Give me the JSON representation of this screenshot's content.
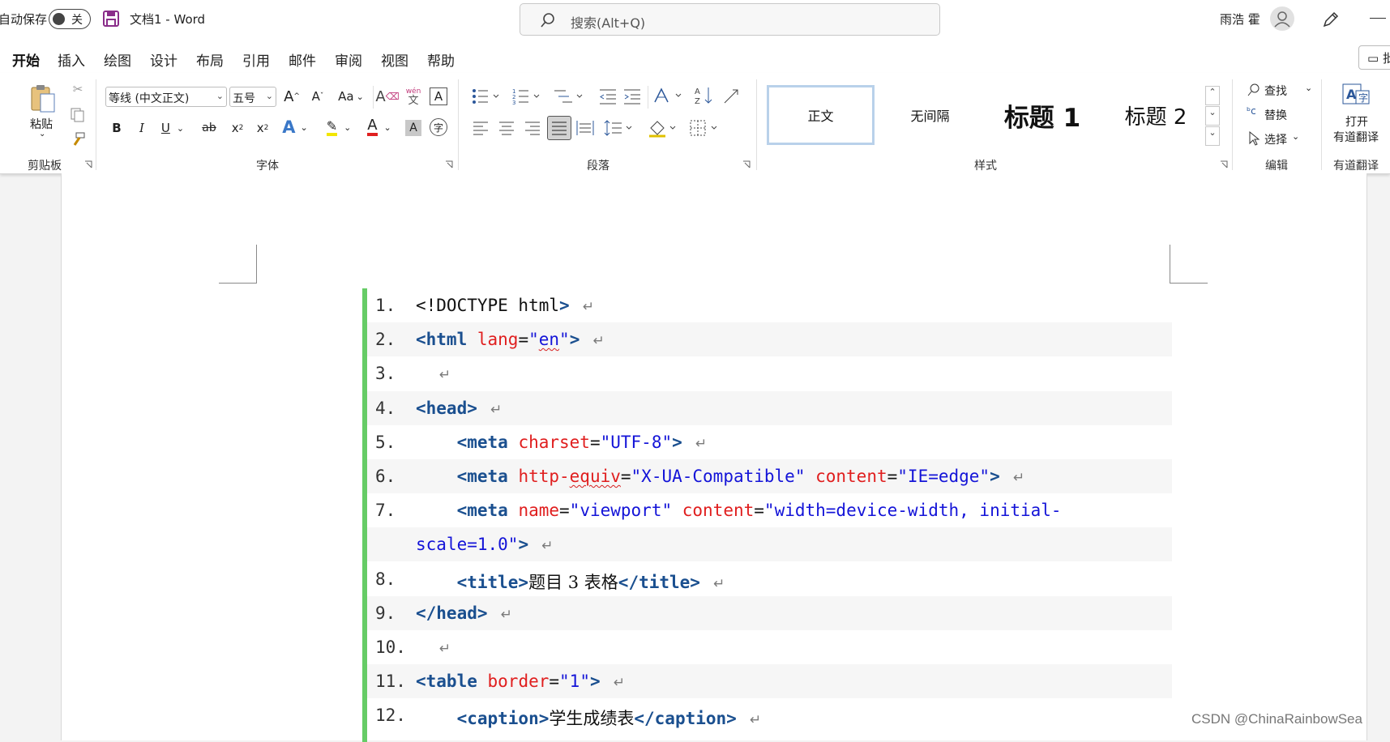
{
  "titlebar": {
    "autosave_label": "自动保存",
    "autosave_state": "关",
    "doc_name": "文档1  -  Word",
    "search_placeholder": "搜索(Alt+Q)",
    "user_name": "雨浩 霍"
  },
  "tabs": [
    {
      "label": "开始",
      "active": true
    },
    {
      "label": "插入"
    },
    {
      "label": "绘图"
    },
    {
      "label": "设计"
    },
    {
      "label": "布局"
    },
    {
      "label": "引用"
    },
    {
      "label": "邮件"
    },
    {
      "label": "审阅"
    },
    {
      "label": "视图"
    },
    {
      "label": "帮助"
    }
  ],
  "comment_button": "批",
  "ribbon": {
    "clipboard": {
      "paste_label": "粘贴",
      "group_label": "剪贴板"
    },
    "font": {
      "font_name": "等线 (中文正文)",
      "font_size": "五号",
      "change_case": "Aa",
      "group_label": "字体",
      "bold": "B",
      "italic": "I",
      "underline": "U",
      "strike": "ab",
      "subscript": "x",
      "superscript": "x",
      "text_effects": "A",
      "font_color": "A",
      "char_shading": "A",
      "phonetic": "wén",
      "phonetic_char": "文",
      "grow": "A",
      "shrink": "A",
      "clear": "A",
      "border_char": "A",
      "enclose": "字"
    },
    "paragraph": {
      "group_label": "段落"
    },
    "styles": {
      "items": [
        {
          "label": "正文",
          "selected": true
        },
        {
          "label": "无间隔"
        },
        {
          "label": "标题 1"
        },
        {
          "label": "标题 2"
        }
      ],
      "group_label": "样式"
    },
    "editing": {
      "find": "查找",
      "replace": "替换",
      "select": "选择",
      "group_label": "编辑"
    },
    "youdao": {
      "open_line1": "打开",
      "open_line2": "有道翻译",
      "group_label": "有道翻译"
    }
  },
  "code_lines": [
    {
      "num": "1.",
      "segments": [
        {
          "t": "<!DOCTYPE html",
          "c": "plain"
        },
        {
          "t": ">",
          "c": "tag"
        }
      ]
    },
    {
      "num": "2.",
      "segments": [
        {
          "t": "<html ",
          "c": "tag"
        },
        {
          "t": "lang",
          "c": "attr"
        },
        {
          "t": "=",
          "c": "plain"
        },
        {
          "t": "\"",
          "c": "val"
        },
        {
          "t": "en",
          "c": "val",
          "squig": true
        },
        {
          "t": "\"",
          "c": "val"
        },
        {
          "t": ">",
          "c": "tag"
        }
      ]
    },
    {
      "num": "3.",
      "segments": [
        {
          "t": " ",
          "c": "plain"
        }
      ]
    },
    {
      "num": "4.",
      "segments": [
        {
          "t": "<head>",
          "c": "tag"
        }
      ]
    },
    {
      "num": "5.",
      "segments": [
        {
          "t": "    <meta ",
          "c": "tag"
        },
        {
          "t": "charset",
          "c": "attr"
        },
        {
          "t": "=",
          "c": "plain"
        },
        {
          "t": "\"UTF-8\"",
          "c": "val"
        },
        {
          "t": ">",
          "c": "tag"
        }
      ]
    },
    {
      "num": "6.",
      "segments": [
        {
          "t": "    <meta ",
          "c": "tag"
        },
        {
          "t": "http-",
          "c": "attr"
        },
        {
          "t": "equiv",
          "c": "attr",
          "squig": true
        },
        {
          "t": "=",
          "c": "plain"
        },
        {
          "t": "\"X-UA-Compatible\" ",
          "c": "val"
        },
        {
          "t": "content",
          "c": "attr"
        },
        {
          "t": "=",
          "c": "plain"
        },
        {
          "t": "\"IE=edge\"",
          "c": "val"
        },
        {
          "t": ">",
          "c": "tag"
        }
      ]
    },
    {
      "num": "7.",
      "segments": [
        {
          "t": "    <meta ",
          "c": "tag"
        },
        {
          "t": "name",
          "c": "attr"
        },
        {
          "t": "=",
          "c": "plain"
        },
        {
          "t": "\"viewport\" ",
          "c": "val"
        },
        {
          "t": "content",
          "c": "attr"
        },
        {
          "t": "=",
          "c": "plain"
        },
        {
          "t": "\"width=device-width, initial-",
          "c": "val"
        }
      ],
      "nomark": true
    },
    {
      "num": "",
      "segments": [
        {
          "t": "scale=1.0\"",
          "c": "val"
        },
        {
          "t": ">",
          "c": "tag"
        }
      ],
      "wrap": true
    },
    {
      "num": "8.",
      "segments": [
        {
          "t": "    <title>",
          "c": "tag"
        },
        {
          "t": "题目 3 表格",
          "c": "plain",
          "cjk": true
        },
        {
          "t": "</title>",
          "c": "tag"
        }
      ]
    },
    {
      "num": "9.",
      "segments": [
        {
          "t": "</head>",
          "c": "tag"
        }
      ]
    },
    {
      "num": "10.",
      "segments": [
        {
          "t": " ",
          "c": "plain"
        }
      ]
    },
    {
      "num": "11.",
      "segments": [
        {
          "t": "<table ",
          "c": "tag"
        },
        {
          "t": "border",
          "c": "attr"
        },
        {
          "t": "=",
          "c": "plain"
        },
        {
          "t": "\"1\"",
          "c": "val"
        },
        {
          "t": ">",
          "c": "tag"
        }
      ]
    },
    {
      "num": "12.",
      "segments": [
        {
          "t": "    <caption>",
          "c": "tag"
        },
        {
          "t": "学生成绩表",
          "c": "plain",
          "cjk": true
        },
        {
          "t": "</caption>",
          "c": "tag"
        }
      ]
    }
  ],
  "paragraph_mark": "↵",
  "watermark": "CSDN @ChinaRainbowSea"
}
